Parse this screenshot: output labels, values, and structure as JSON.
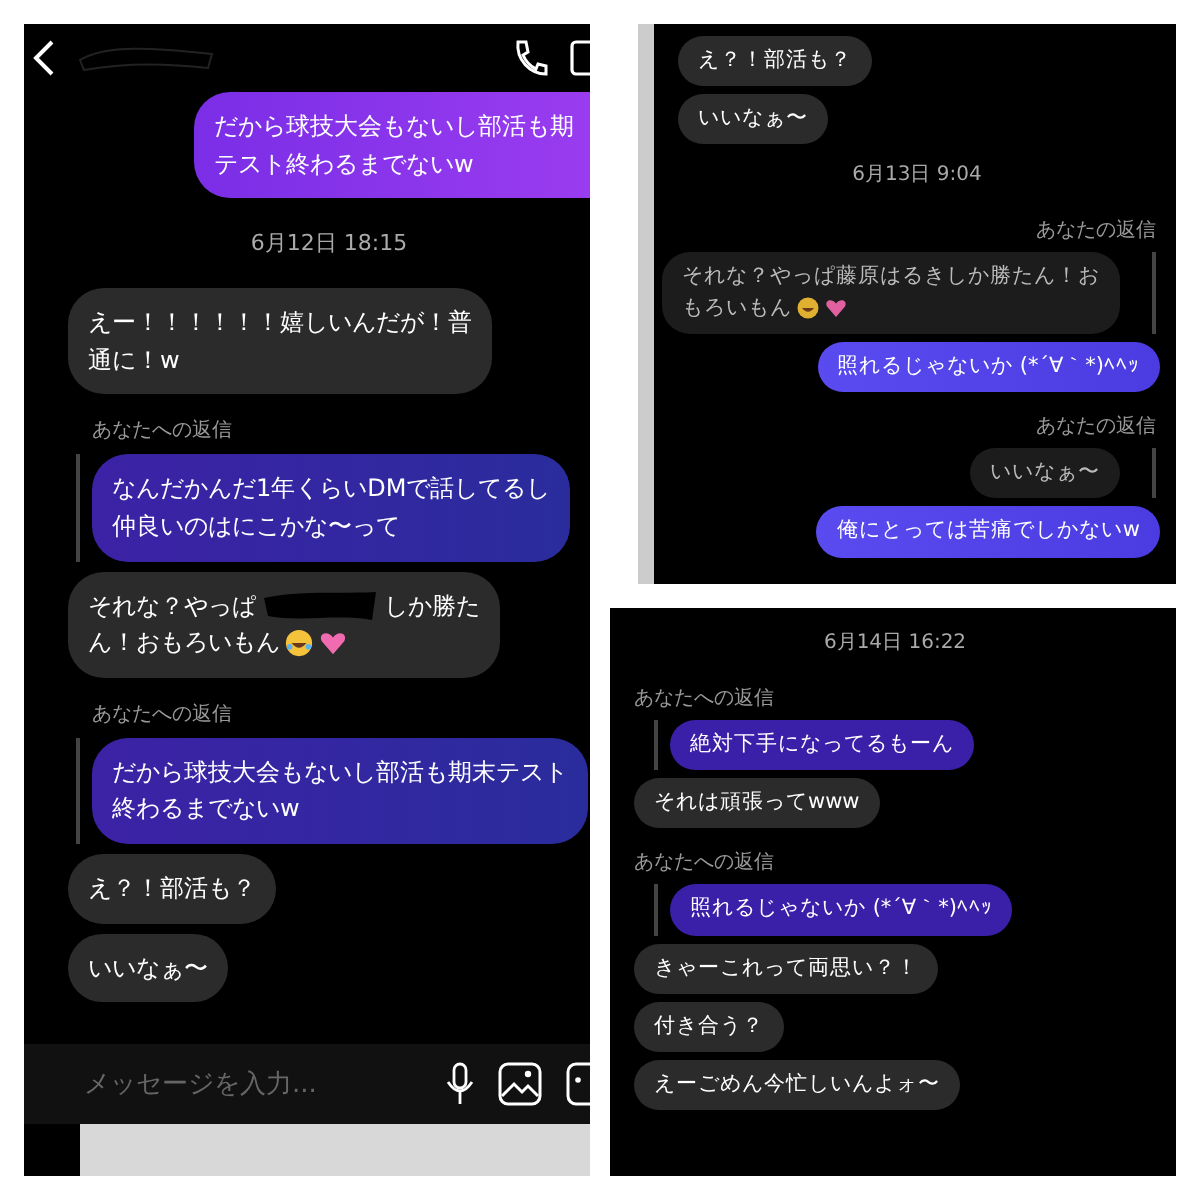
{
  "left_chat": {
    "messages": [
      {
        "kind": "sent",
        "lines": [
          "だから球技大会もないし部活も期",
          "テスト終わるまでないw"
        ]
      },
      {
        "kind": "date",
        "lines": [
          "6月12日 18:15"
        ]
      },
      {
        "kind": "received",
        "lines": [
          "えー！！！！！！嬉しいんだが！普",
          "通に！w"
        ]
      },
      {
        "kind": "reply_note",
        "lines": [
          "あなたへの返信"
        ]
      },
      {
        "kind": "quote_sent",
        "lines": [
          "なんだかんだ1年くらいDMで話してるし",
          "仲良いのはにこかな〜って"
        ]
      },
      {
        "kind": "received_redacted",
        "lines": [
          "それな？やっぱ",
          "しか勝た",
          "ん！おもろいもん"
        ]
      },
      {
        "kind": "reply_note",
        "lines": [
          "あなたへの返信"
        ]
      },
      {
        "kind": "quote_sent",
        "lines": [
          "だから球技大会もないし部活も期末テスト",
          "終わるまでないw"
        ]
      },
      {
        "kind": "received",
        "lines": [
          "え？！部活も？"
        ]
      },
      {
        "kind": "received",
        "lines": [
          "いいなぁ〜"
        ]
      }
    ],
    "input": {
      "placeholder": "メッセージを入力..."
    }
  },
  "top_right_chat": {
    "messages": [
      {
        "kind": "received",
        "lines": [
          "え？！部活も？"
        ]
      },
      {
        "kind": "received",
        "lines": [
          "いいなぁ〜"
        ]
      },
      {
        "kind": "date",
        "lines": [
          "6月13日 9:04"
        ]
      },
      {
        "kind": "reply_note_right",
        "lines": [
          "あなたの返信"
        ]
      },
      {
        "kind": "quote_received",
        "lines": [
          "それな？やっぱ藤原はるきしか勝たん！お",
          "もろいもん"
        ]
      },
      {
        "kind": "sent",
        "lines": [
          "照れるじゃないか (*´∀｀*)ﾍﾍｯ"
        ]
      },
      {
        "kind": "reply_note_right",
        "lines": [
          "あなたの返信"
        ]
      },
      {
        "kind": "quote_received",
        "lines": [
          "いいなぁ〜"
        ]
      },
      {
        "kind": "sent",
        "lines": [
          "俺にとっては苦痛でしかないw"
        ]
      }
    ]
  },
  "bottom_right_chat": {
    "messages": [
      {
        "kind": "date",
        "lines": [
          "6月14日 16:22"
        ]
      },
      {
        "kind": "reply_note",
        "lines": [
          "あなたへの返信"
        ]
      },
      {
        "kind": "quote_sent",
        "lines": [
          "絶対下手になってるもーん"
        ]
      },
      {
        "kind": "received",
        "lines": [
          "それは頑張ってwww"
        ]
      },
      {
        "kind": "reply_note",
        "lines": [
          "あなたへの返信"
        ]
      },
      {
        "kind": "quote_sent",
        "lines": [
          "照れるじゃないか (*´∀｀*)ﾍﾍｯ"
        ]
      },
      {
        "kind": "received",
        "lines": [
          "きゃーこれって両思い？！"
        ]
      },
      {
        "kind": "received",
        "lines": [
          "付き合う？"
        ]
      },
      {
        "kind": "received",
        "lines": [
          "えーごめん今忙しいんよォ〜"
        ]
      }
    ]
  }
}
